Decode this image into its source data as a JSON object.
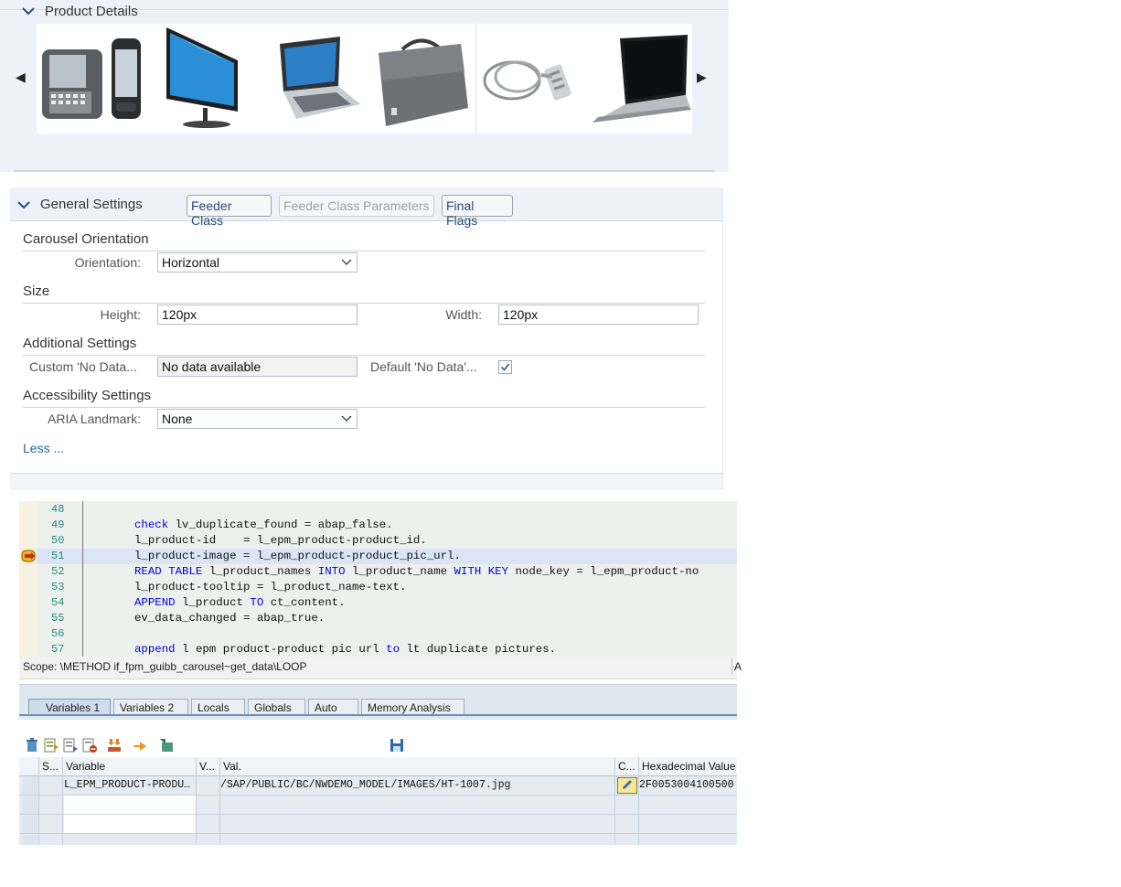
{
  "carousel": {
    "prev_arrow": "◀",
    "next_arrow": "▶",
    "items": [
      "phone-devices",
      "monitor",
      "laptop",
      "laptop-bag",
      "cable-lock",
      "notebook"
    ]
  },
  "product_details": {
    "title": "Product Details"
  },
  "general_settings": {
    "title": "General Settings",
    "buttons": {
      "feeder_class": "Feeder Class",
      "feeder_class_parameters": "Feeder Class Parameters",
      "final_flags": "Final Flags"
    },
    "sections": {
      "carousel_orientation": "Carousel Orientation",
      "size": "Size",
      "additional": "Additional Settings",
      "accessibility": "Accessibility Settings"
    },
    "fields": {
      "orientation_label": "Orientation:",
      "orientation_value": "Horizontal",
      "height_label": "Height:",
      "height_value": "120px",
      "width_label": "Width:",
      "width_value": "120px",
      "custom_no_data_label": "Custom 'No Data...",
      "custom_no_data_value": "No data available",
      "default_no_data_label": "Default 'No Data'...",
      "default_no_data_checked": true,
      "aria_label": "ARIA Landmark:",
      "aria_value": "None"
    },
    "less_link": "Less ..."
  },
  "debugger": {
    "code_lines": [
      {
        "n": "48",
        "text": ""
      },
      {
        "n": "49",
        "text": "check lv_duplicate_found = abap_false."
      },
      {
        "n": "50",
        "text": "l_product-id    = l_epm_product-product_id."
      },
      {
        "n": "51",
        "text": "l_product-image = l_epm_product-product_pic_url."
      },
      {
        "n": "52",
        "text": "READ TABLE l_product_names INTO l_product_name WITH KEY node_key = l_epm_product-no"
      },
      {
        "n": "53",
        "text": "l_product-tooltip = l_product_name-text."
      },
      {
        "n": "54",
        "text": "APPEND l_product TO ct_content."
      },
      {
        "n": "55",
        "text": "ev_data_changed = abap_true."
      },
      {
        "n": "56",
        "text": ""
      },
      {
        "n": "57",
        "text": "append l epm product-product pic url to lt duplicate pictures."
      }
    ],
    "current_line": "51",
    "scope": "Scope: \\METHOD if_fpm_guibb_carousel~get_data\\LOOP",
    "scope_right": "A",
    "tabs": [
      "Variables 1",
      "Variables 2",
      "Locals",
      "Globals",
      "Auto",
      "Memory Analysis"
    ],
    "active_tab": "Variables 1",
    "toolbar_icons": [
      "delete-icon",
      "insert-row-icon",
      "append-row-icon",
      "delete-row-icon",
      "expand-icon",
      "move-icon",
      "transfer-icon",
      "save-icon"
    ],
    "table": {
      "headers": [
        "S...",
        "Variable",
        "V...",
        "Val.",
        "C...",
        "Hexadecimal Value"
      ],
      "rows": [
        {
          "variable": "L_EPM_PRODUCT-PRODU…",
          "value": "/SAP/PUBLIC/BC/NWDEMO_MODEL/IMAGES/HT-1007.jpg",
          "hex": "2F0053004100500"
        },
        {
          "variable": "",
          "value": "",
          "hex": ""
        },
        {
          "variable": "",
          "value": "",
          "hex": ""
        }
      ]
    }
  }
}
